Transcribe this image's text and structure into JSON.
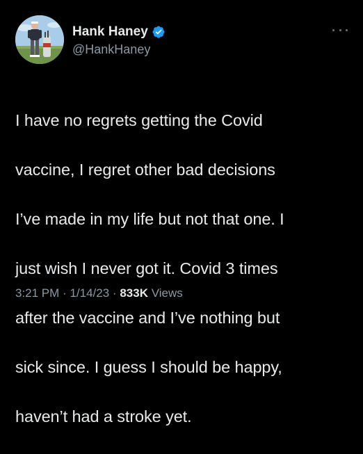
{
  "author": {
    "display_name": "Hank Haney",
    "handle": "@HankHaney",
    "verified": true
  },
  "icons": {
    "verified": "verified-badge-icon",
    "more": "more-options-icon"
  },
  "colors": {
    "background": "#000000",
    "text_primary": "#e7e9ea",
    "text_secondary": "#8b98a5",
    "verified_blue": "#1d9bf0"
  },
  "tweet": {
    "lines": [
      "I have no regrets getting the Covid",
      "vaccine, I regret other bad decisions",
      "I’ve made in my life but not that one. I",
      "just wish I never got it. Covid 3 times",
      "after the vaccine and I’ve nothing but",
      "sick since. I guess I should be happy,",
      "haven’t had a stroke yet."
    ]
  },
  "meta": {
    "time": "3:21 PM",
    "separator": "·",
    "date": "1/14/23",
    "views_count": "833K",
    "views_label": "Views"
  }
}
